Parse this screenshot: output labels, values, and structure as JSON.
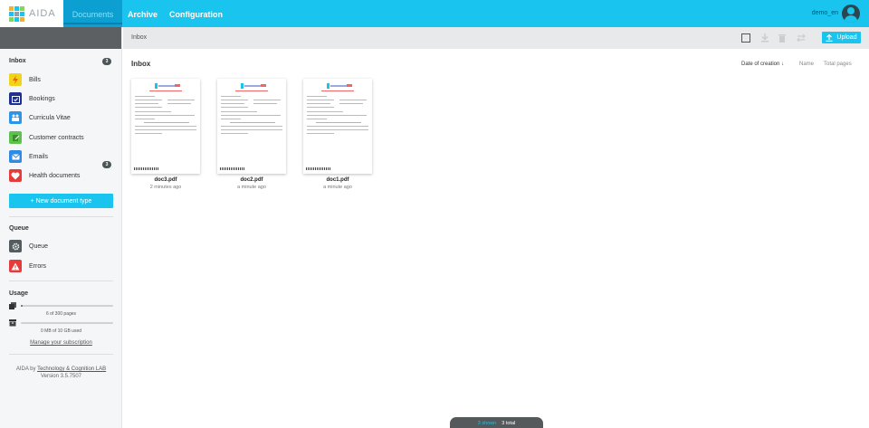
{
  "app": {
    "logo_text": "AIDA",
    "nav": [
      "Documents",
      "Archive",
      "Configuration"
    ],
    "username": "demo_en"
  },
  "toolbar": {
    "breadcrumb": "Inbox",
    "upload_label": "Upload"
  },
  "sidebar": {
    "inbox_title": "Inbox",
    "inbox_count": "3",
    "items": [
      {
        "label": "Bills",
        "icon": "lightning-icon",
        "color": "#f2d31b"
      },
      {
        "label": "Bookings",
        "icon": "calendar-check-icon",
        "color": "#1e2f8f"
      },
      {
        "label": "Curricula Vitae",
        "icon": "people-icon",
        "color": "#2c95e8"
      },
      {
        "label": "Customer contracts",
        "icon": "contract-icon",
        "color": "#5cc34a",
        "count": "3"
      },
      {
        "label": "Emails",
        "icon": "envelope-icon",
        "color": "#2f8ae3"
      },
      {
        "label": "Health documents",
        "icon": "heart-icon",
        "color": "#e53b3b"
      }
    ],
    "new_type_label": "+  New document type",
    "queue_title": "Queue",
    "queue_items": [
      {
        "label": "Queue",
        "icon": "gear-icon",
        "color": "#555c60"
      },
      {
        "label": "Errors",
        "icon": "warning-icon",
        "color": "#e53b3b"
      }
    ],
    "usage_title": "Usage",
    "pages_usage": {
      "text": "6 of 300 pages",
      "fraction": 0.02
    },
    "storage_usage": {
      "text": "0 MB of 10 GB used",
      "fraction": 0.0
    },
    "manage_link": "Manage your subscription",
    "footer_prefix": "AIDA by",
    "footer_link": "Technology & Cognition LAB",
    "version": "Version 3.5.7507"
  },
  "main": {
    "title": "Inbox",
    "sort_options": [
      "Date of creation",
      "Name",
      "Total pages"
    ],
    "documents": [
      {
        "name": "doc3.pdf",
        "time": "2 minutes ago"
      },
      {
        "name": "doc2.pdf",
        "time": "a minute ago"
      },
      {
        "name": "doc1.pdf",
        "time": "a minute ago"
      }
    ]
  },
  "status": {
    "shown": "3 shown",
    "total": "3 total"
  },
  "colors": {
    "accent": "#19c4ee",
    "topbar": "#19c4ee",
    "dark_badge": "#4d5559"
  }
}
